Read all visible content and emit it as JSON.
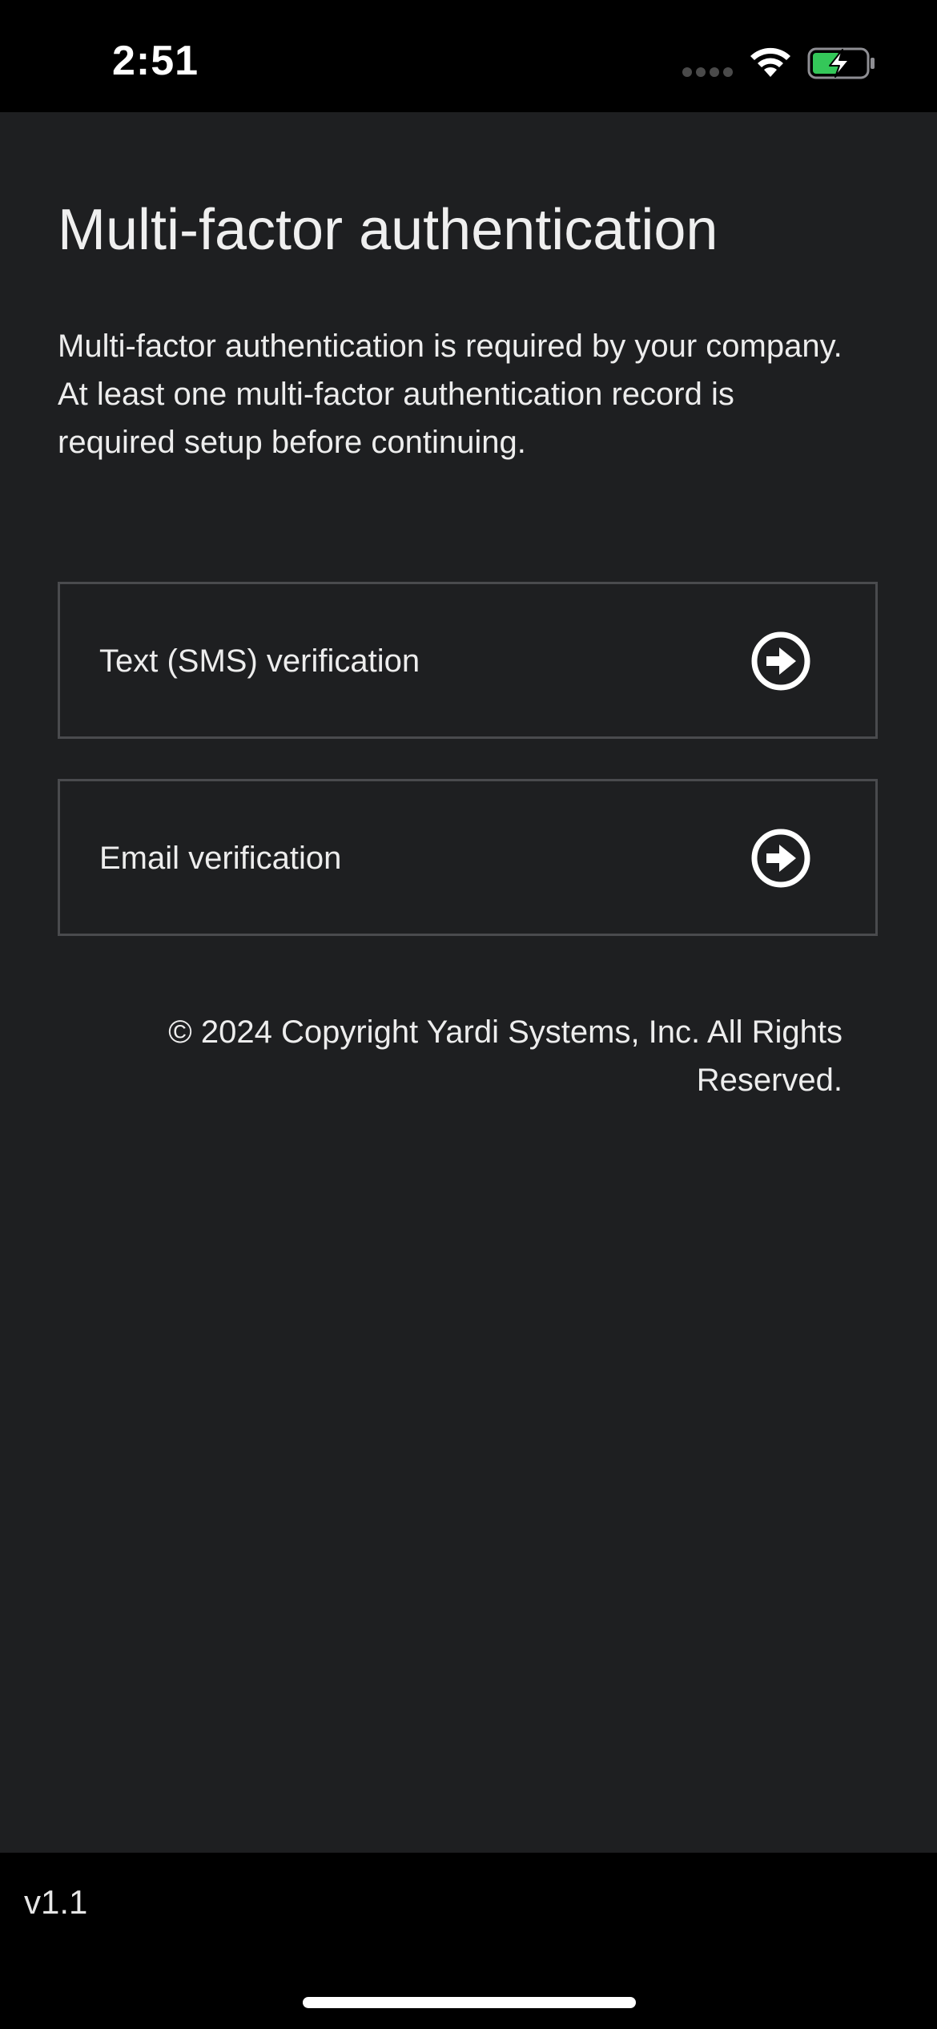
{
  "status_bar": {
    "time": "2:51",
    "signal_icon": "cellular-signal-icon",
    "wifi_icon": "wifi-icon",
    "battery_icon": "battery-charging-icon",
    "battery_color": "#34c759"
  },
  "main": {
    "title": "Multi-factor authentication",
    "intro": "Multi-factor authentication is required by your company. At least one multi-factor authentication record is required setup before continuing.",
    "options": [
      {
        "label": "Text (SMS) verification",
        "icon": "arrow-right-circle-icon"
      },
      {
        "label": "Email verification",
        "icon": "arrow-right-circle-icon"
      }
    ],
    "copyright": "© 2024 Copyright Yardi Systems, Inc. All Rights Reserved."
  },
  "footer": {
    "version": "v1.1"
  },
  "colors": {
    "background": "#1e1f21",
    "border": "#4a4b4e",
    "text": "#ededed"
  }
}
